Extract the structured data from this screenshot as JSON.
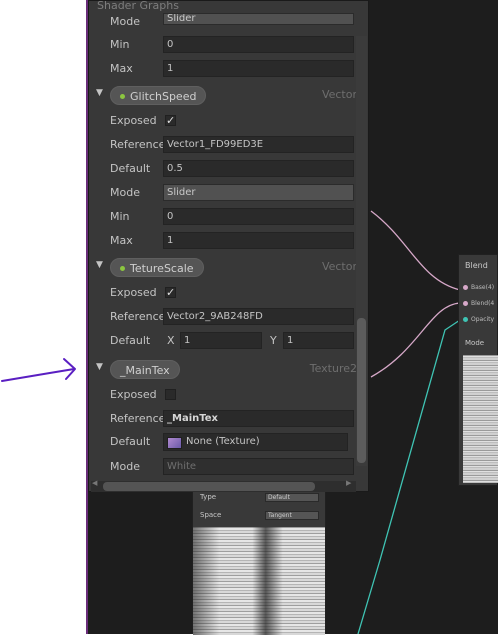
{
  "blackboard": {
    "title": "Shader Graphs",
    "top_rows": [
      {
        "label": "Mode",
        "value": "Slider"
      },
      {
        "label": "Min",
        "value": "0"
      },
      {
        "label": "Max",
        "value": "1"
      }
    ],
    "glitch": {
      "name": "GlitchSpeed",
      "type": "Vector",
      "exposed_label": "Exposed",
      "reference_label": "Reference",
      "reference": "Vector1_FD99ED3E",
      "default_label": "Default",
      "default": "0.5",
      "mode_label": "Mode",
      "mode": "Slider",
      "min_label": "Min",
      "min": "0",
      "max_label": "Max",
      "max": "1"
    },
    "teture": {
      "name": "TetureScale",
      "type": "Vector",
      "exposed_label": "Exposed",
      "reference_label": "Reference",
      "reference": "Vector2_9AB248FD",
      "default_label": "Default",
      "x_label": "X",
      "x": "1",
      "y_label": "Y",
      "y": "1"
    },
    "maintex": {
      "name": "_MainTex",
      "type": "Texture2",
      "exposed_label": "Exposed",
      "reference_label": "Reference",
      "reference": "_MainTex",
      "default_label": "Default",
      "default": "None (Texture)",
      "mode_label": "Mode",
      "mode": "White"
    }
  },
  "blend_node": {
    "title": "Blend",
    "ports": [
      "Base(4)",
      "Blend(4",
      "Opacity"
    ],
    "mode_label": "Mode"
  },
  "bottom_node": {
    "type_label": "Type",
    "type_value": "Default",
    "space_label": "Space",
    "space_value": "Tangent"
  },
  "colors": {
    "arrow": "#5a1fc2",
    "wire_pink": "#d6a8c8",
    "wire_teal": "#3fc4b4",
    "accent_green": "#8cc640"
  }
}
